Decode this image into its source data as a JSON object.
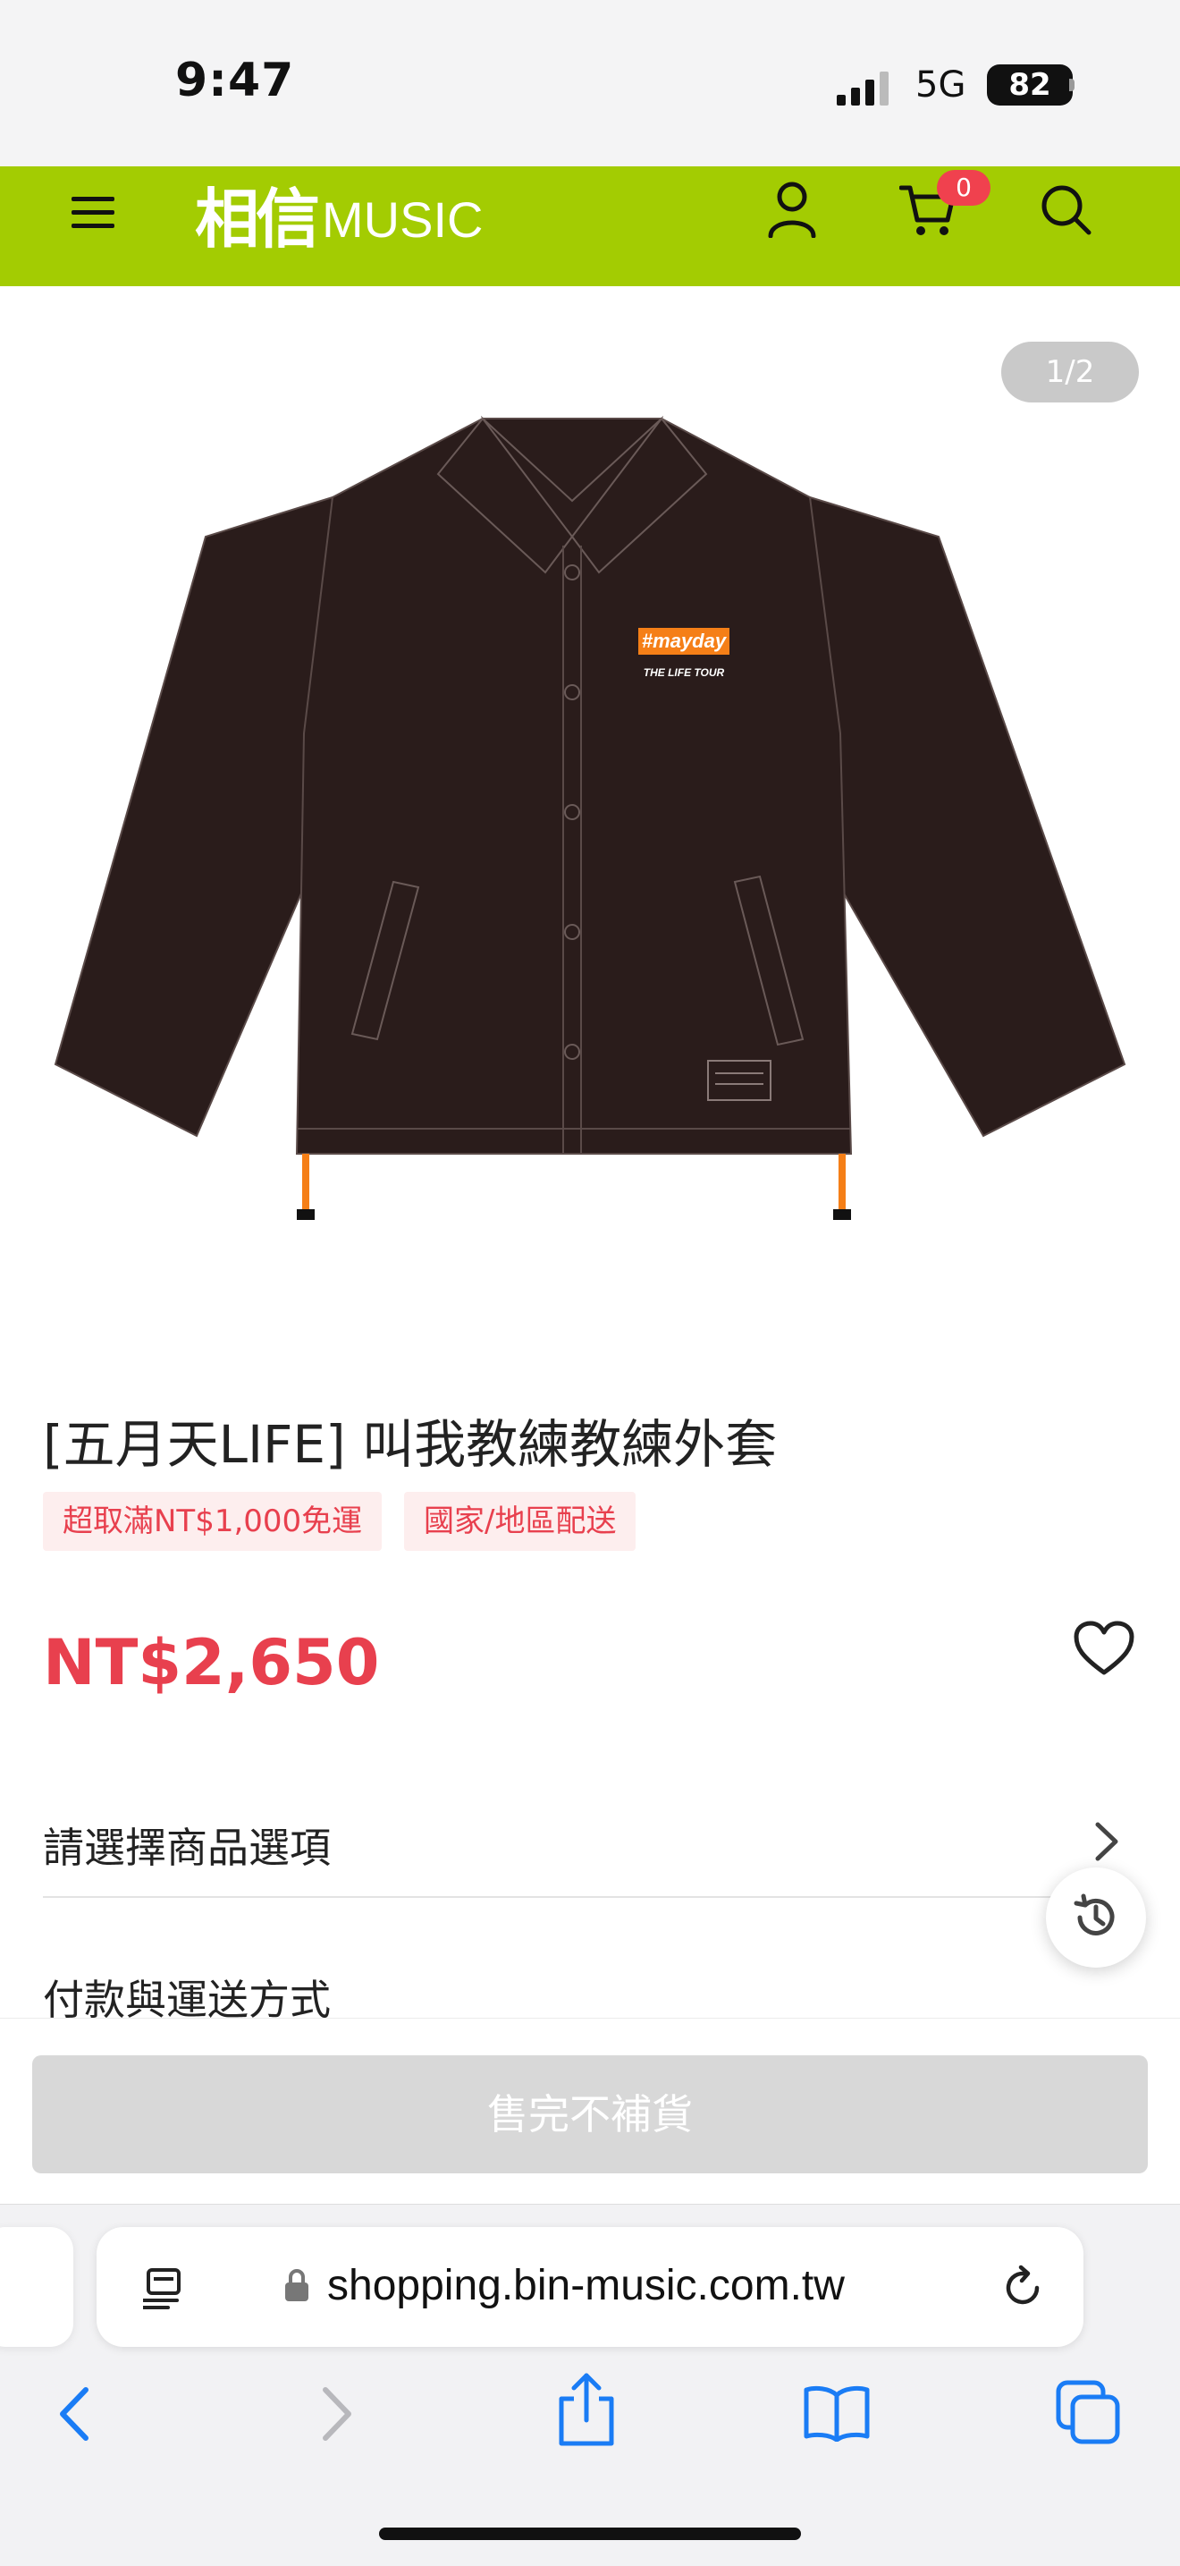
{
  "status_bar": {
    "time": "9:47",
    "network": "5G",
    "battery": "82"
  },
  "header": {
    "logo_cn": "相信",
    "logo_music": "MUSIC",
    "cart_count": "0"
  },
  "product": {
    "image_counter": "1/2",
    "image_logo_text": "#mayday",
    "image_tour_text": "THE LIFE TOUR",
    "title": "[五月天LIFE] 叫我教練教練外套",
    "tags": [
      "超取滿NT$1,000免運",
      "國家/地區配送"
    ],
    "price": "NT$2,650"
  },
  "rows": {
    "options_label": "請選擇商品選項",
    "payment_label": "付款與運送方式"
  },
  "action": {
    "sold_out_label": "售完不補貨"
  },
  "browser": {
    "url": "shopping.bin-music.com.tw"
  },
  "colors": {
    "brand_green": "#a3cc02",
    "price_red": "#e8404e",
    "jacket": "#2a1c1b",
    "accent_orange": "#f57f17"
  }
}
